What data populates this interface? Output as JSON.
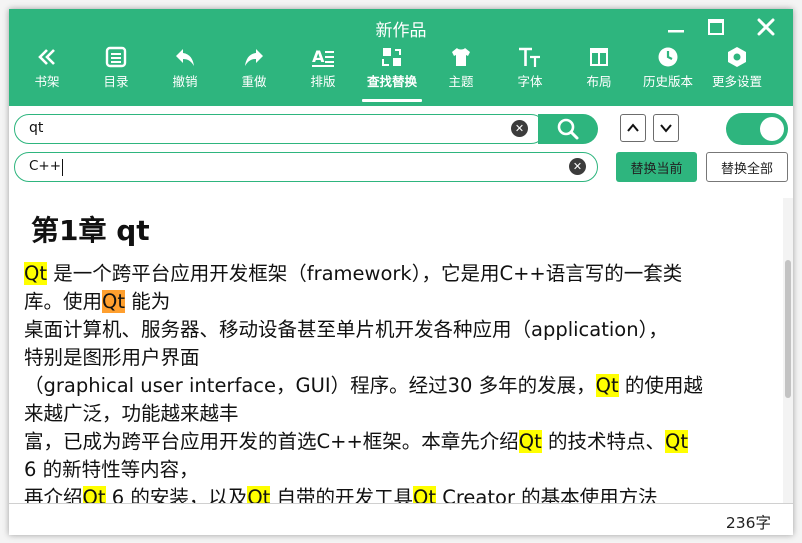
{
  "window": {
    "title": "新作品"
  },
  "toolbar": [
    {
      "label": "书架",
      "icon": "double-chevron-left-icon"
    },
    {
      "label": "目录",
      "icon": "list-icon"
    },
    {
      "label": "撤销",
      "icon": "undo-icon"
    },
    {
      "label": "重做",
      "icon": "redo-icon"
    },
    {
      "label": "排版",
      "icon": "format-icon"
    },
    {
      "label": "查找替换",
      "icon": "find-replace-icon",
      "active": true
    },
    {
      "label": "主题",
      "icon": "shirt-icon"
    },
    {
      "label": "字体",
      "icon": "font-icon"
    },
    {
      "label": "布局",
      "icon": "layout-icon"
    },
    {
      "label": "历史版本",
      "icon": "clock-icon"
    },
    {
      "label": "更多设置",
      "icon": "settings-icon"
    }
  ],
  "search": {
    "find_value": "qt",
    "replace_value": "C++",
    "regex_toggle_on": true
  },
  "buttons": {
    "replace_current": "替换当前",
    "replace_all": "替换全部"
  },
  "document": {
    "chapter_title": "第1章 qt",
    "lines": [
      [
        {
          "t": "Qt",
          "hl": "match"
        },
        {
          "t": " 是一个跨平台应用开发框架（framework），它是用C++语言写的一套类"
        }
      ],
      [
        {
          "t": "库。使用"
        },
        {
          "t": "Qt",
          "hl": "current"
        },
        {
          "t": " 能为"
        }
      ],
      [
        {
          "t": "桌面计算机、服务器、移动设备甚至单片机开发各种应用（application），"
        }
      ],
      [
        {
          "t": "特别是图形用户界面"
        }
      ],
      [
        {
          "t": "（graphical user interface，GUI）程序。经过30 多年的发展，"
        },
        {
          "t": "Qt",
          "hl": "match"
        },
        {
          "t": " 的使用越"
        }
      ],
      [
        {
          "t": "来越广泛，功能越来越丰"
        }
      ],
      [
        {
          "t": "富，已成为跨平台应用开发的首选C++框架。本章先介绍"
        },
        {
          "t": "Qt",
          "hl": "match"
        },
        {
          "t": " 的技术特点、"
        },
        {
          "t": "Qt",
          "hl": "match"
        }
      ],
      [
        {
          "t": "6 的新特性等内容，"
        }
      ],
      [
        {
          "t": "再介绍"
        },
        {
          "t": "Qt",
          "hl": "match"
        },
        {
          "t": " 6 的安装，以及"
        },
        {
          "t": "Qt",
          "hl": "match"
        },
        {
          "t": " 自带的开发工具"
        },
        {
          "t": "Qt",
          "hl": "match"
        },
        {
          "t": " Creator 的基本使用方法"
        }
      ]
    ]
  },
  "status": {
    "word_count": "236字"
  },
  "colors": {
    "accent": "#2eb57e",
    "match_highlight": "#ffff00",
    "current_highlight": "#ff9f2e"
  }
}
